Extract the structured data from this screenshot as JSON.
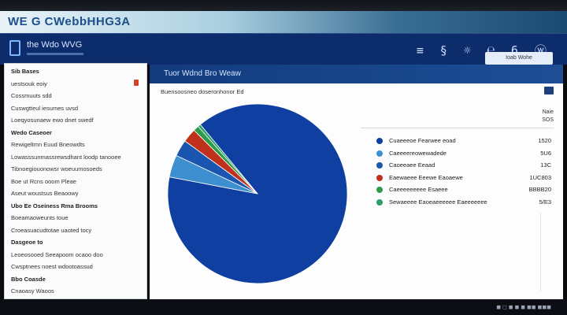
{
  "window": {
    "title": "WE G CWebbHHG3A"
  },
  "header": {
    "app_title": "the Wdo WVG",
    "icons": "≡ § ☼ ℮ 6 ⓦ",
    "button_label": "Ioab Wohe"
  },
  "sidebar": {
    "section1": "Sib Bases",
    "items1": [
      "uestsouk eoiy",
      "Cossmuuts sdd",
      "Cuswgtteul iesumes uvsd",
      "Loeqyosunaew ewo dnet swedf"
    ],
    "section2": "Wedo Caseoer",
    "items2": [
      "Rewigeltmn Euud Bneowdts",
      "Lowasssunmassrewsdhant loodp tanooee",
      "Tibnoegiouonowsr woeuumosoeds"
    ],
    "items3": [
      "Boe ut Rcns ooom Pleae",
      "Aseut woustsus Beaoowy"
    ],
    "section3": "Ubo Ee Oseiness Rma Brooms",
    "items4": [
      "Boeamaoweunts toue",
      "Croeasuacudtotae uaoted tocy"
    ],
    "section4": "Dasgeoe to",
    "items5": [
      "Leoeosooed Seeapoom ocaoo doo",
      "Cwsptnees noest wdootoassud"
    ],
    "section5": "Bbo Coasde",
    "items6": [
      "Cnaoasy Waoos"
    ]
  },
  "main": {
    "title": "Tuor Wdnd Bro Weaw",
    "toolbar_text": "Buensoosneo doseronhonor Ed",
    "legend_header_1": "Naie",
    "legend_header_2": "SOS"
  },
  "chart_data": {
    "type": "pie",
    "title": "",
    "slices": [
      {
        "label": "Cuaeeeoe Fearwee eoad",
        "value": 89,
        "color": "#0f3fa0",
        "value_text": "1520"
      },
      {
        "label": "Caeeeereowewadede",
        "value": 4,
        "color": "#3d8fd0",
        "value_text": "5U6"
      },
      {
        "label": "Caoeeaee Eeaad",
        "value": 3,
        "color": "#1a56b0",
        "value_text": "13C"
      },
      {
        "label": "Eaewaeee Eeewe Eaoaewe",
        "value": 2.5,
        "color": "#c0311c",
        "value_text": "1UC803"
      },
      {
        "label": "Caeeeeeeeee Esaeee",
        "value": 1,
        "color": "#2e9a4a",
        "value_text": "BBBB20"
      },
      {
        "label": "Sewaeeee Eaoeaeeeeee Eaeeeeeee",
        "value": 0.5,
        "color": "#2a9f6a",
        "value_text": "5/E3"
      }
    ]
  },
  "taskbar": {
    "text": "◼ ◻ ◼ ◼ ◼ ◼◼ ◼◼◼"
  }
}
